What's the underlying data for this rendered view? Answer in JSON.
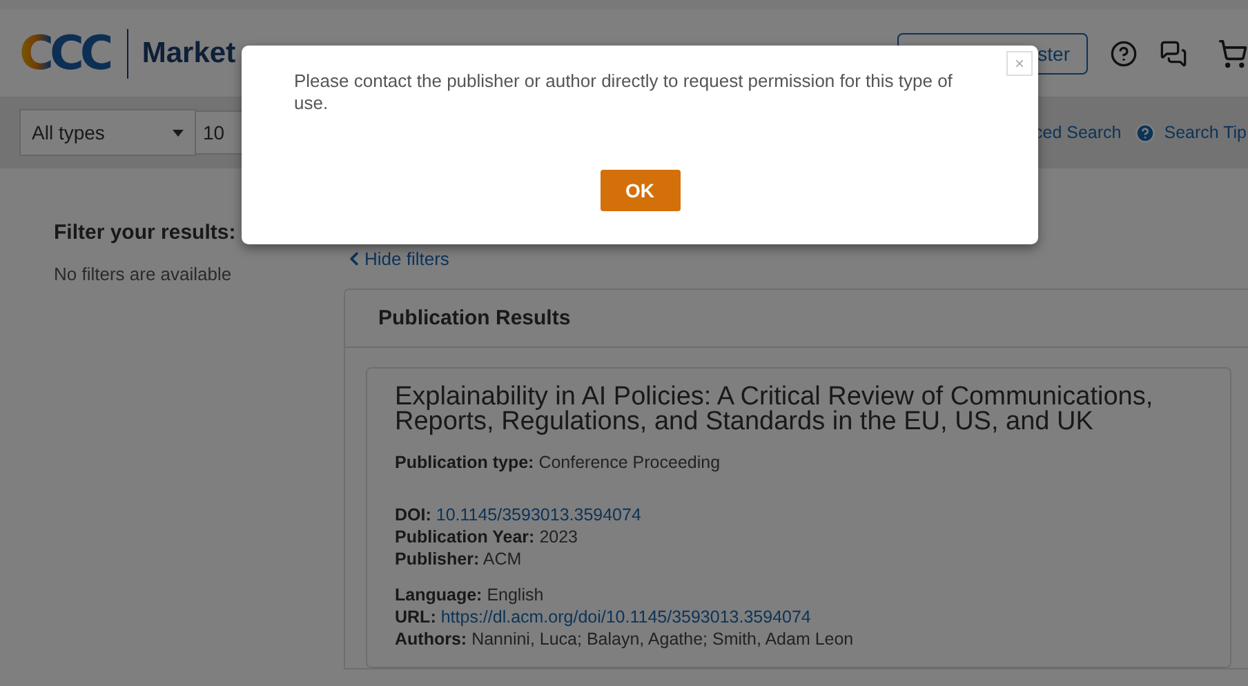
{
  "header": {
    "logo": "CCC",
    "brand": "Market",
    "sign_in": "ster"
  },
  "search": {
    "type_select": "All types",
    "query": "10",
    "links": [
      "ced Search",
      "Search Tip"
    ]
  },
  "sidebar": {
    "title": "Filter your results:",
    "empty_text": "No filters are available"
  },
  "hide_filters": "Hide filters",
  "results": {
    "title": "Publication Results",
    "items": [
      {
        "title": "Explainability in AI Policies: A Critical Review of Communications, Reports, Regulations, and Standards in the EU, US, and UK",
        "groups": [
          [
            {
              "label": "Publication type:",
              "value": "Conference Proceeding",
              "kind": "text"
            }
          ],
          [
            {
              "label": "DOI:",
              "value": "10.1145/3593013.3594074",
              "kind": "link"
            },
            {
              "label": "Publication Year:",
              "value": "2023",
              "kind": "text"
            },
            {
              "label": "Publisher:",
              "value": "ACM",
              "kind": "text"
            }
          ],
          [
            {
              "label": "Language:",
              "value": "English",
              "kind": "text"
            },
            {
              "label": "URL:",
              "value": "https://dl.acm.org/doi/10.1145/3593013.3594074",
              "kind": "link"
            },
            {
              "label": "Authors:",
              "value": "Nannini, Luca; Balayn, Agathe; Smith, Adam Leon",
              "kind": "text"
            }
          ]
        ]
      }
    ]
  },
  "modal": {
    "message": "Please contact the publisher or author directly to request permission for this type of use.",
    "button": "OK",
    "close": "×"
  }
}
